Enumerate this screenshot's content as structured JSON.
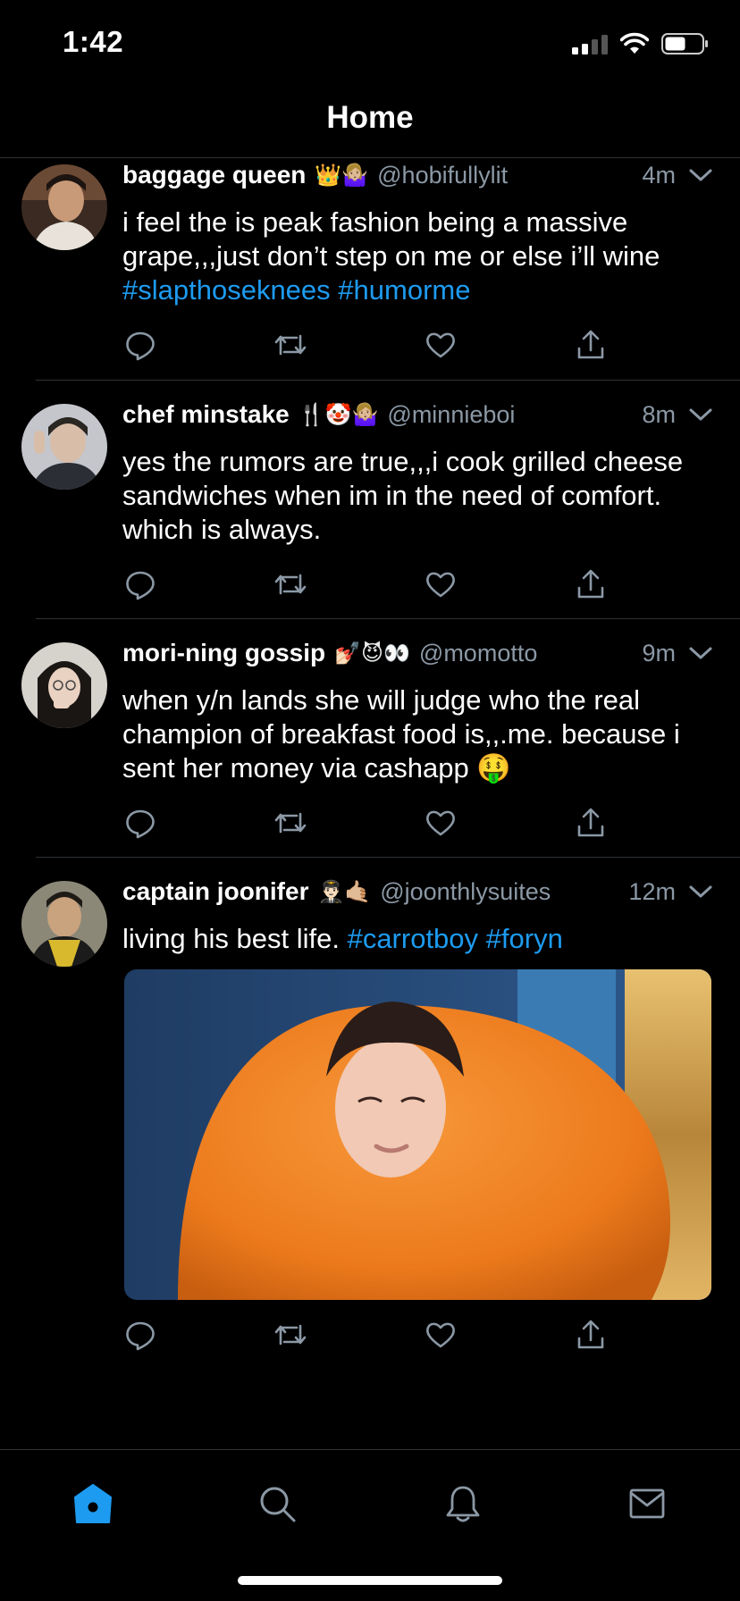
{
  "status_bar": {
    "time": "1:42"
  },
  "header": {
    "title": "Home"
  },
  "tweets": [
    {
      "display_name": "baggage queen",
      "emojis": "👑🤷🏼‍♀️",
      "handle": "@hobifullylit",
      "time": "4m",
      "text_plain": "i feel the is peak fashion being a massive grape,,,just don’t step on me or else i’ll wine",
      "hashtags": [
        "#slapthoseknees",
        "#humorme"
      ]
    },
    {
      "display_name": "chef minstake",
      "emojis": "🍴🤡🤷🏼‍♀️",
      "handle": "@minnieboi",
      "time": "8m",
      "text_plain": "yes the rumors are true,,,i cook grilled cheese sandwiches when im in the need of comfort. which is always.",
      "hashtags": []
    },
    {
      "display_name": "mori-ning gossip",
      "emojis": "💅🏻😈👀",
      "handle": "@momotto",
      "time": "9m",
      "text_plain": "when y/n lands she will judge who the real champion of breakfast food is,,.me. because i sent her money via cashapp 🤑",
      "hashtags": []
    },
    {
      "display_name": "captain joonifer",
      "emojis": "👨🏻‍✈️🤙🏼",
      "handle": "@joonthlysuites",
      "time": "12m",
      "text_plain": "living his best life.",
      "hashtags": [
        "#carrotboy",
        "#foryn"
      ]
    }
  ],
  "colors": {
    "background": "#000000",
    "accent": "#1d9bf0",
    "secondary_text": "#8b98a5",
    "divider": "#2f3336"
  },
  "tabs": [
    {
      "icon": "home-icon",
      "active": true
    },
    {
      "icon": "search-icon",
      "active": false
    },
    {
      "icon": "bell-icon",
      "active": false
    },
    {
      "icon": "mail-icon",
      "active": false
    }
  ]
}
